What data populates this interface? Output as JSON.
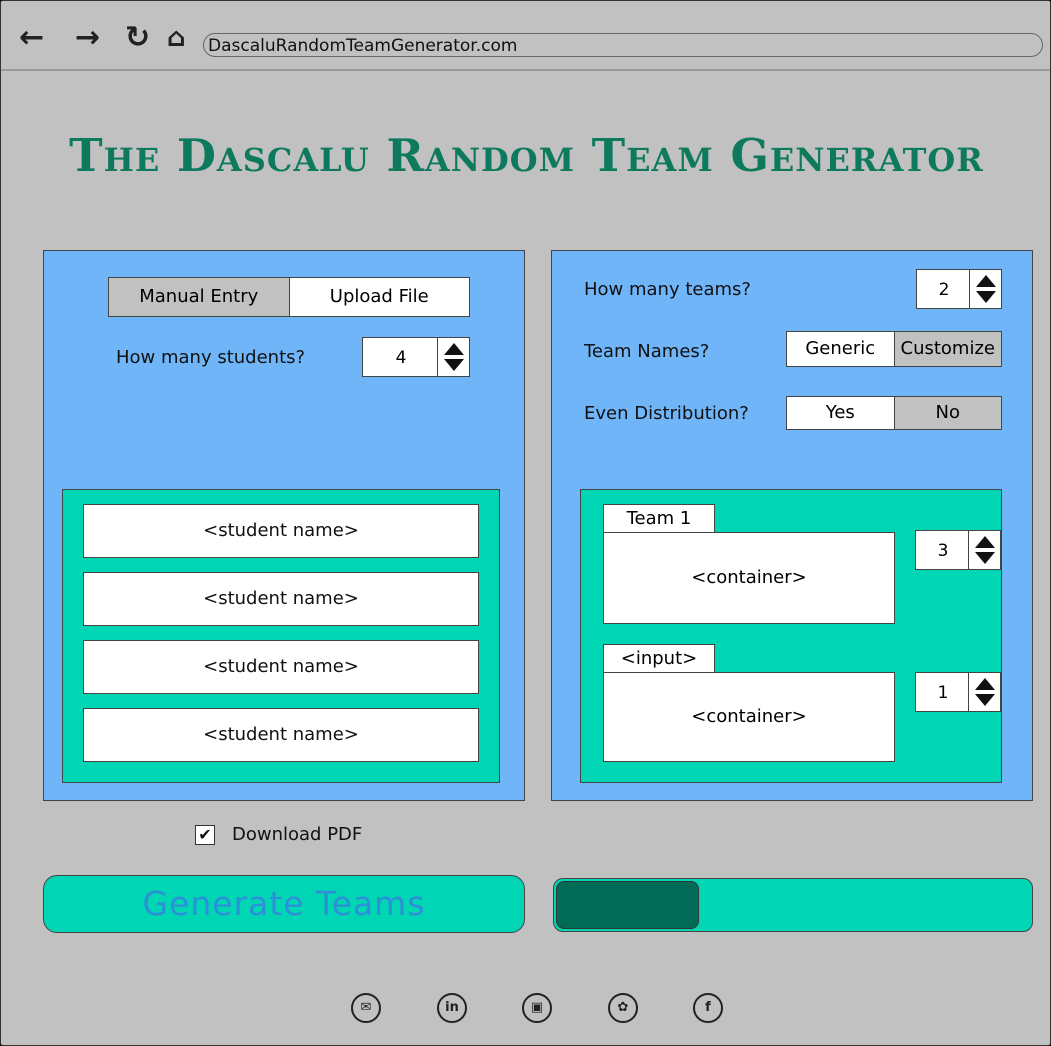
{
  "browser": {
    "url": "DascaluRandomTeamGenerator.com"
  },
  "title": "The Dascalu Random Team Generator",
  "left_panel": {
    "tabs": [
      "Manual Entry",
      "Upload File"
    ],
    "students_label": "How many students?",
    "students_value": "4",
    "student_fields": [
      "<student name>",
      "<student name>",
      "<student name>",
      "<student name>"
    ]
  },
  "right_panel": {
    "teams_label": "How many teams?",
    "teams_value": "2",
    "team_names_label": "Team Names?",
    "team_names_options": [
      "Generic",
      "Customize"
    ],
    "even_label": "Even Distribution?",
    "even_options": [
      "Yes",
      "No"
    ],
    "teams": [
      {
        "name": "Team 1",
        "container": "<container>",
        "count": "3"
      },
      {
        "name": "<input>",
        "container": "<container>",
        "count": "1"
      }
    ]
  },
  "download_pdf": {
    "label": "Download PDF",
    "checked": true
  },
  "generate_button": "Generate Teams",
  "progress": {
    "fraction": 0.3
  },
  "social_icons": [
    "email-icon",
    "linkedin-icon",
    "instagram-icon",
    "twitter-icon",
    "facebook-icon"
  ],
  "colors": {
    "accent": "#00d6b4",
    "panel": "#6fb5f8",
    "title": "#0e7a5d",
    "progress_fill": "#016b55"
  }
}
